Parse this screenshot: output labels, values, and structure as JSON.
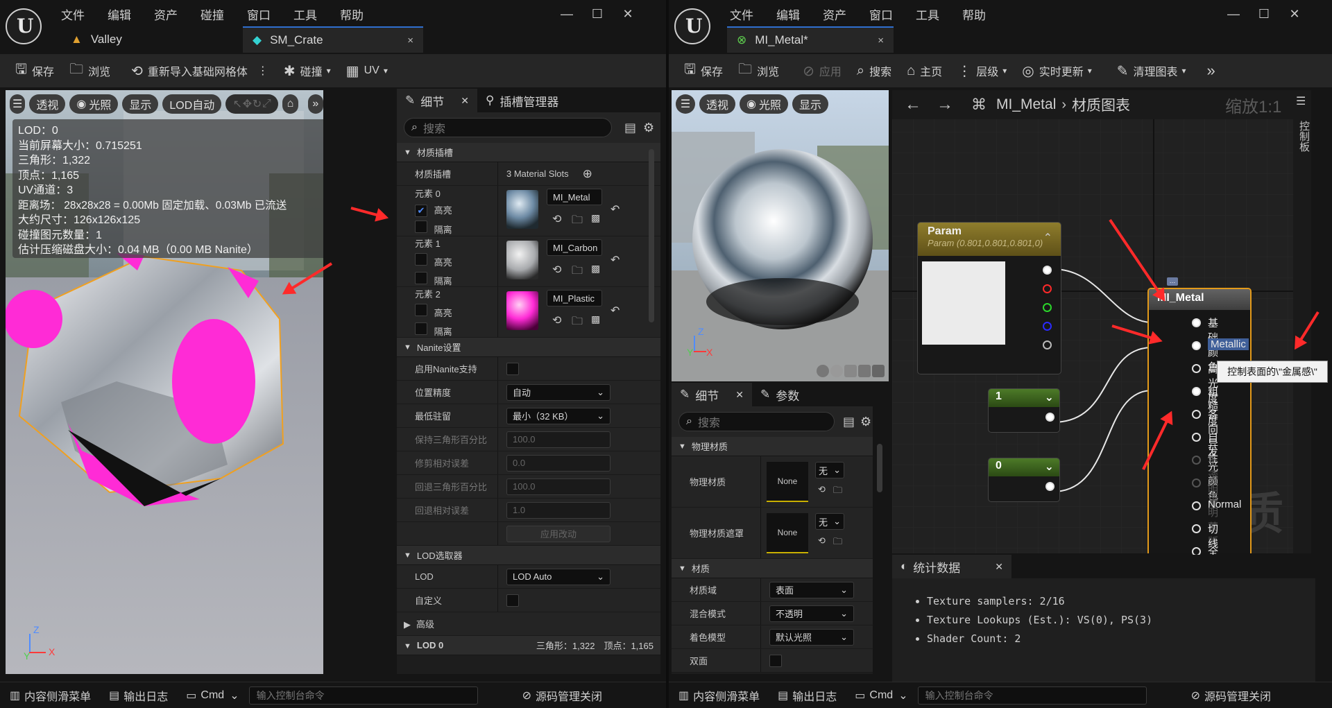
{
  "menu": [
    "文件",
    "编辑",
    "资产",
    "碰撞",
    "窗口",
    "工具",
    "帮助"
  ],
  "left": {
    "tabs": {
      "valley": "Valley",
      "crate": "SM_Crate",
      "close": "×"
    },
    "toolbar": {
      "save": "保存",
      "browse": "浏览",
      "reimport": "重新导入基础网格体",
      "collision": "碰撞",
      "uv": "UV"
    },
    "viewport": {
      "perspective": "透视",
      "lit": "光照",
      "show": "显示",
      "lod_auto": "LOD自动"
    },
    "stats": [
      "LOD：0",
      "当前屏幕大小：0.715251",
      "三角形：1,322",
      "顶点：1,165",
      "UV通道：3",
      "距离场： 28x28x28 = 0.00Mb 固定加载、0.03Mb 已流送",
      "大约尺寸：126x126x125",
      "碰撞图元数量：1",
      "估计压缩磁盘大小：0.04 MB（0.00 MB Nanite）"
    ],
    "details": {
      "tab_details": "细节",
      "tab_socket": "插槽管理器",
      "search": "搜索",
      "sec_slots": "材质插槽",
      "slots_label": "材质插槽",
      "slots_value": "3 Material Slots",
      "elements": [
        {
          "name": "元素 0",
          "highlight": "高亮",
          "isolate": "隔离",
          "material": "MI_Metal",
          "checked": true
        },
        {
          "name": "元素 1",
          "highlight": "高亮",
          "isolate": "隔离",
          "material": "MI_Carbon",
          "checked": false
        },
        {
          "name": "元素 2",
          "highlight": "高亮",
          "isolate": "隔离",
          "material": "MI_Plastic",
          "checked": false
        }
      ],
      "sec_nanite": "Nanite设置",
      "nanite_enable": "启用Nanite支持",
      "pos_precision": "位置精度",
      "pos_precision_val": "自动",
      "min_residency": "最低驻留",
      "min_residency_val": "最小（32 KB）",
      "keep_tri": "保持三角形百分比",
      "keep_tri_val": "100.0",
      "trim_err": "修剪相对误差",
      "trim_err_val": "0.0",
      "fallback_tri": "回退三角形百分比",
      "fallback_tri_val": "100.0",
      "fallback_err": "回退相对误差",
      "fallback_err_val": "1.0",
      "apply": "应用改动",
      "sec_lod": "LOD选取器",
      "lod": "LOD",
      "lod_val": "LOD Auto",
      "custom": "自定义",
      "advanced": "高级",
      "lod0": "LOD 0",
      "lod0_stats": "三角形：1,322　顶点：1,165"
    },
    "status": {
      "drawer": "内容侧滑菜单",
      "log": "输出日志",
      "cmd": "Cmd",
      "cmd_placeholder": "输入控制台命令",
      "scm": "源码管理关闭"
    }
  },
  "right": {
    "tab": "MI_Metal*",
    "close": "×",
    "toolbar": {
      "save": "保存",
      "browse": "浏览",
      "apply": "应用",
      "search": "搜索",
      "home": "主页",
      "hierarchy": "层级",
      "live": "实时更新",
      "clean": "清理图表"
    },
    "viewport": {
      "perspective": "透视",
      "lit": "光照",
      "show": "显示"
    },
    "details": {
      "tab_details": "细节",
      "tab_params": "参数",
      "search": "搜索",
      "sec_phys": "物理材质",
      "phys_mat": "物理材质",
      "phys_mask": "物理材质遮罩",
      "none": "None",
      "dd": "无",
      "sec_mat": "材质",
      "domain": "材质域",
      "domain_val": "表面",
      "blend": "混合模式",
      "blend_val": "不透明",
      "shading": "着色模型",
      "shading_val": "默认光照",
      "twosided": "双面"
    },
    "graph": {
      "crumb_a": "MI_Metal",
      "crumb_b": "材质图表",
      "zoom": "缩放1:1",
      "side_label": "控制板",
      "param_title": "Param",
      "param_sub": "Param (0.801,0.801,0.801,0)",
      "const1": "1",
      "const0": "0",
      "mat_title": "MI_Metal",
      "pins": [
        "基础颜色",
        "Metallic",
        "高光度",
        "粗糙度",
        "各向异性",
        "自发光颜色",
        "不透明度",
        "不透明蒙版",
        "Normal",
        "切线",
        "全局位置偏移"
      ],
      "tooltip": "控制表面的\\\"金属感\\\"",
      "watermark": "材质",
      "stats_tab": "统计数据",
      "stats_lines": [
        "Texture samplers: 2/16",
        "Texture Lookups (Est.): VS(0), PS(3)",
        "Shader Count: 2"
      ]
    },
    "status": {
      "drawer": "内容侧滑菜单",
      "log": "输出日志",
      "cmd": "Cmd",
      "cmd_placeholder": "输入控制台命令",
      "scm": "源码管理关闭"
    }
  },
  "colors": {
    "accent": "#2f6fcf",
    "pin_green": "#6bd13f",
    "magenta": "#ff2bd6",
    "arrow": "#ff2a2a",
    "node_gold": "#c9a33a"
  }
}
